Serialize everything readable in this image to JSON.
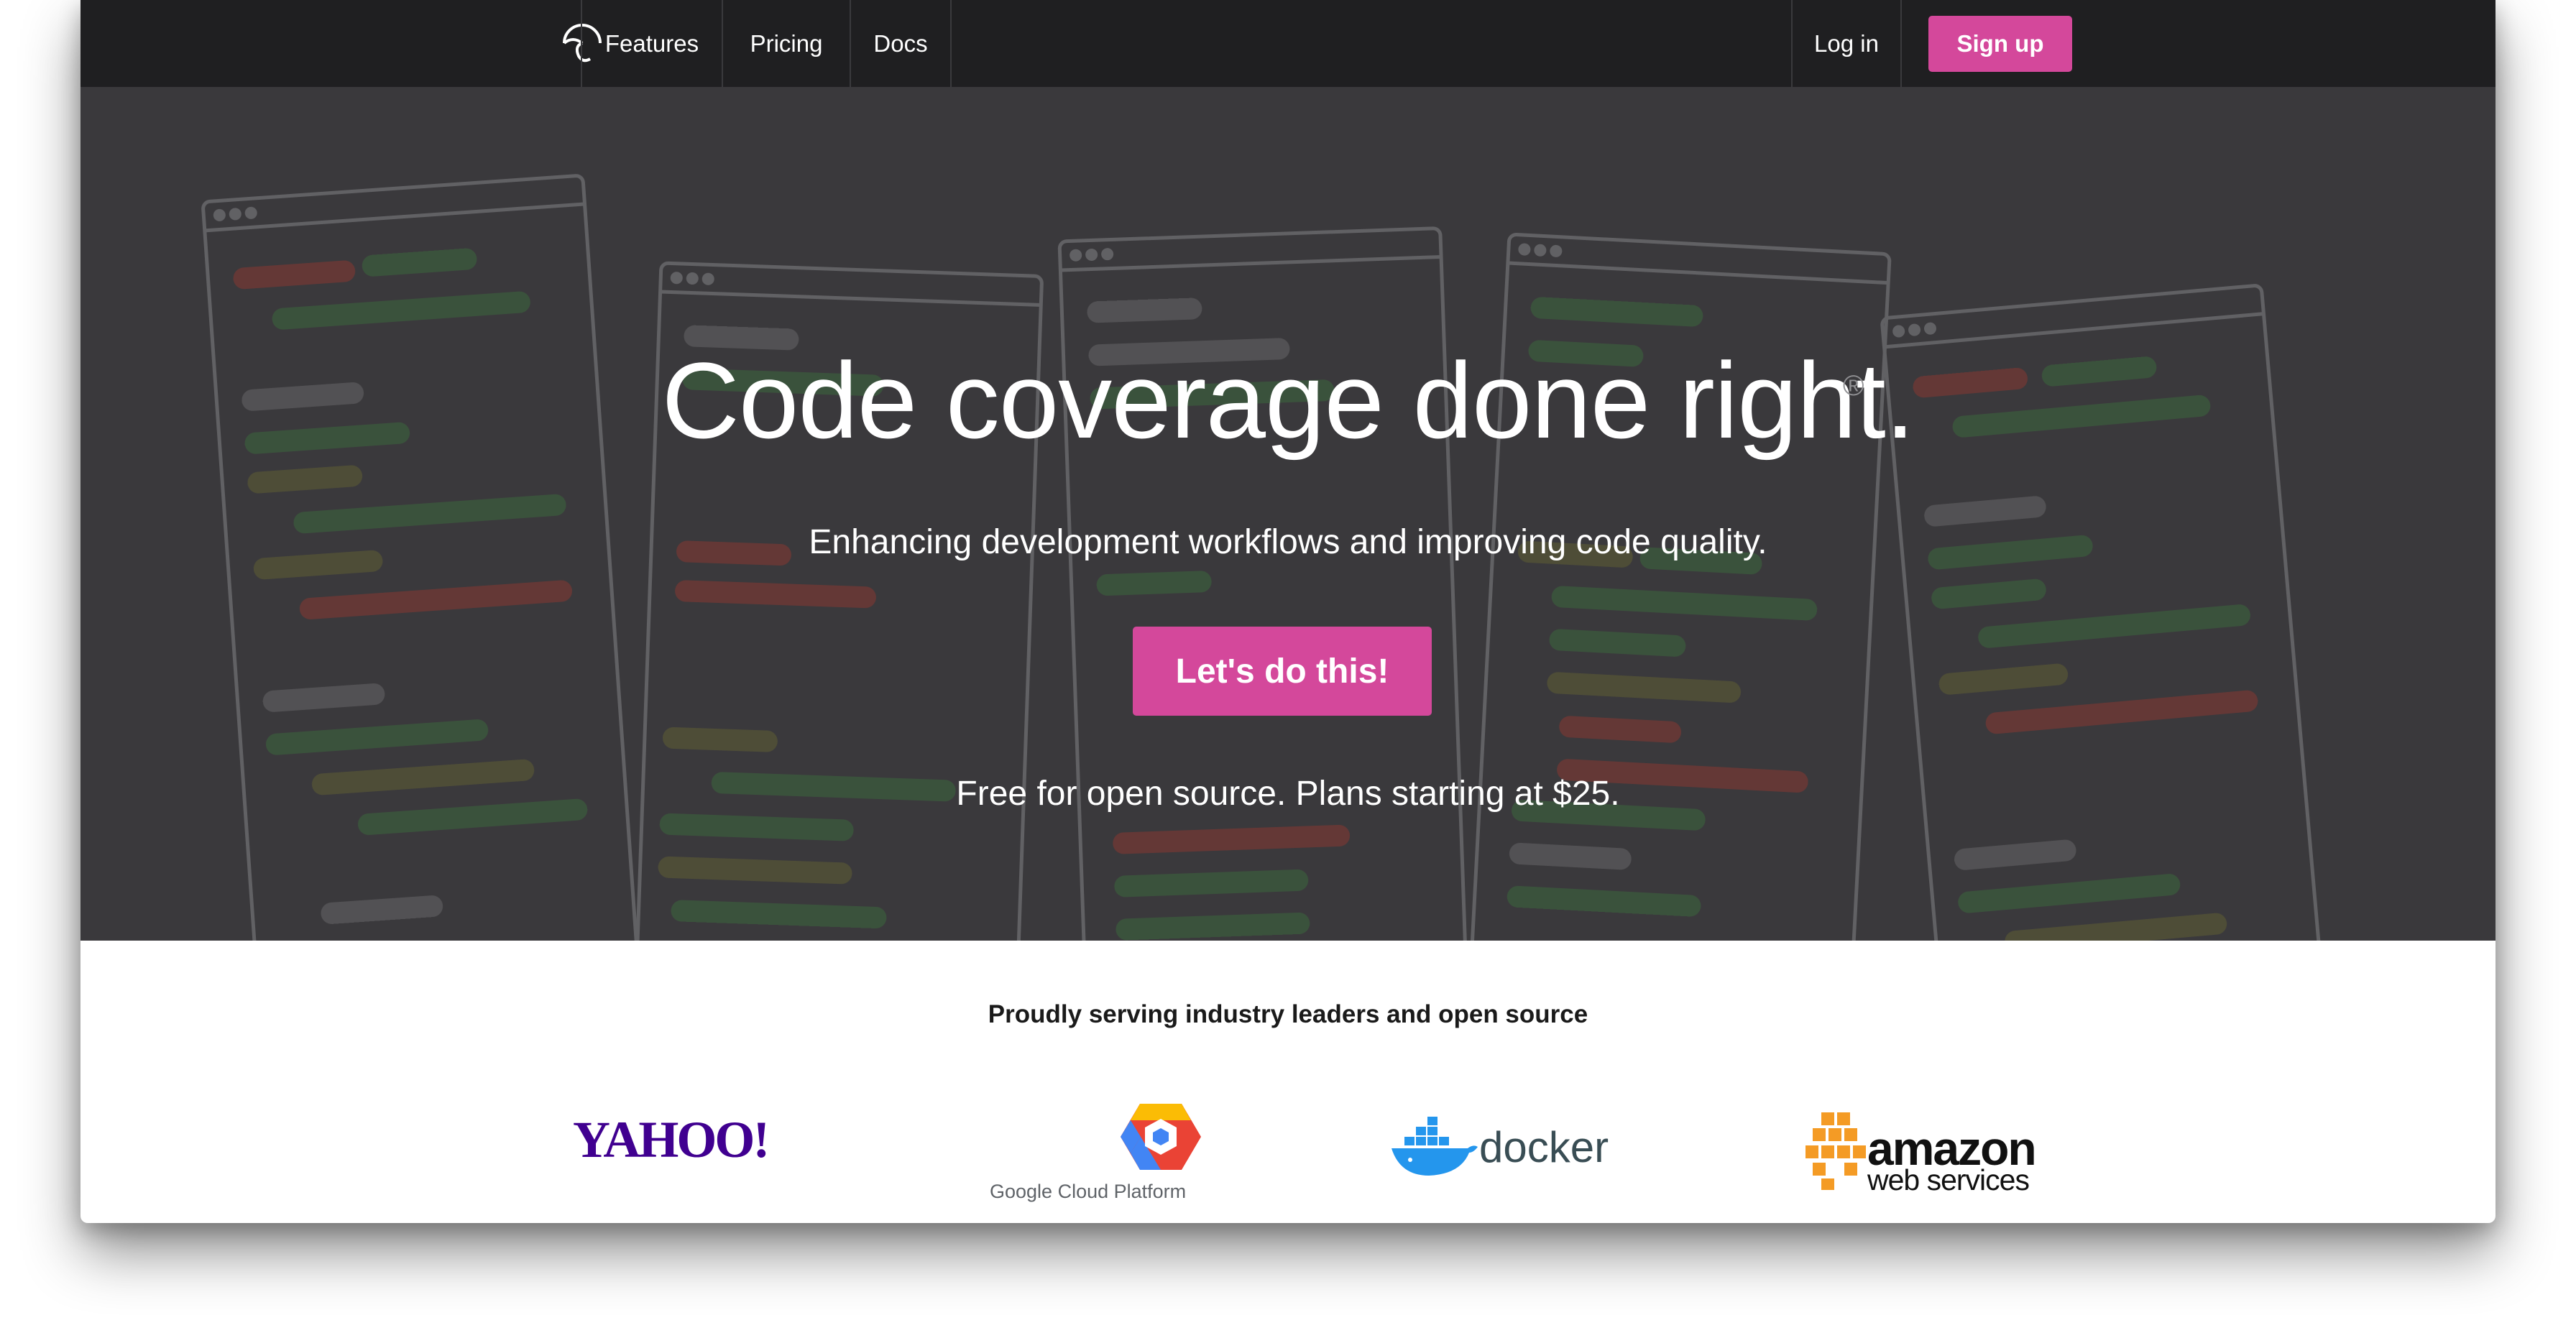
{
  "nav": {
    "logo_icon": "umbrella-icon",
    "links": [
      "Features",
      "Pricing",
      "Docs"
    ],
    "login_label": "Log in",
    "signup_label": "Sign up"
  },
  "hero": {
    "headline": "Code coverage done right.",
    "registered_mark": "®",
    "subheadline": "Enhancing development workflows and improving code quality.",
    "cta_label": "Let's do this!",
    "pricing_text": "Free for open source. Plans starting at $25."
  },
  "clients": {
    "title": "Proudly serving industry leaders and open source",
    "logos": {
      "yahoo": "YAHOO!",
      "gcp": "Google Cloud Platform",
      "docker": "docker",
      "amazon": "amazon",
      "aws": "web services"
    }
  },
  "colors": {
    "nav_bg": "#1f1f21",
    "hero_bg": "#3a393c",
    "accent": "#d4489b"
  }
}
